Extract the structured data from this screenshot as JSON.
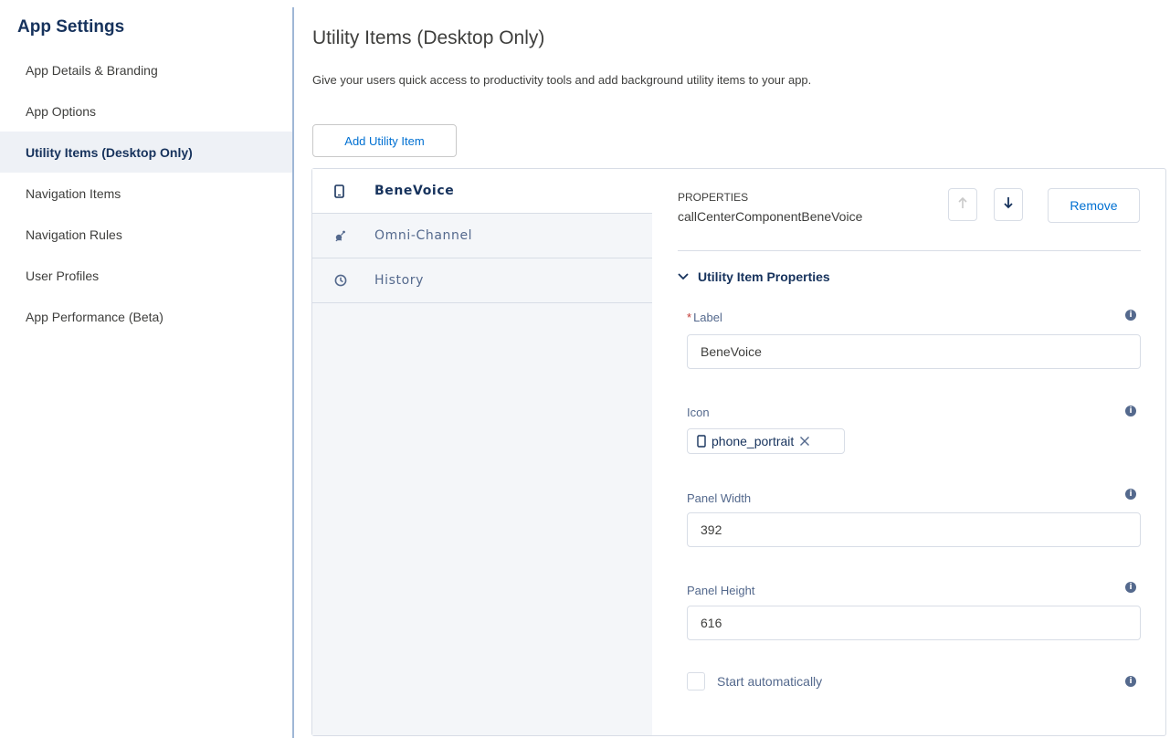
{
  "sidebar": {
    "title": "App Settings",
    "items": [
      {
        "label": "App Details & Branding",
        "active": false
      },
      {
        "label": "App Options",
        "active": false
      },
      {
        "label": "Utility Items (Desktop Only)",
        "active": true
      },
      {
        "label": "Navigation Items",
        "active": false
      },
      {
        "label": "Navigation Rules",
        "active": false
      },
      {
        "label": "User Profiles",
        "active": false
      },
      {
        "label": "App Performance (Beta)",
        "active": false
      }
    ]
  },
  "main": {
    "title": "Utility Items (Desktop Only)",
    "description": "Give your users quick access to productivity tools and add background utility items to your app.",
    "add_button": "Add Utility Item"
  },
  "utility_items": [
    {
      "label": "BeneVoice",
      "icon": "phone-portrait-icon",
      "active": true
    },
    {
      "label": "Omni-Channel",
      "icon": "omni-channel-icon",
      "active": false
    },
    {
      "label": "History",
      "icon": "clock-icon",
      "active": false
    }
  ],
  "properties": {
    "header_label": "PROPERTIES",
    "component_name": "callCenterComponentBeneVoice",
    "remove_button": "Remove",
    "section_title": "Utility Item Properties",
    "label_field": {
      "label": "Label",
      "required_mark": "*",
      "value": "BeneVoice"
    },
    "icon_field": {
      "label": "Icon",
      "value": "phone_portrait"
    },
    "panel_width": {
      "label": "Panel Width",
      "value": "392"
    },
    "panel_height": {
      "label": "Panel Height",
      "value": "616"
    },
    "start_auto": {
      "label": "Start automatically",
      "checked": false
    }
  },
  "colors": {
    "accent": "#0070d2",
    "sidebar_active_bg": "#eef1f6",
    "heading": "#16325c",
    "required": "#c23934"
  }
}
